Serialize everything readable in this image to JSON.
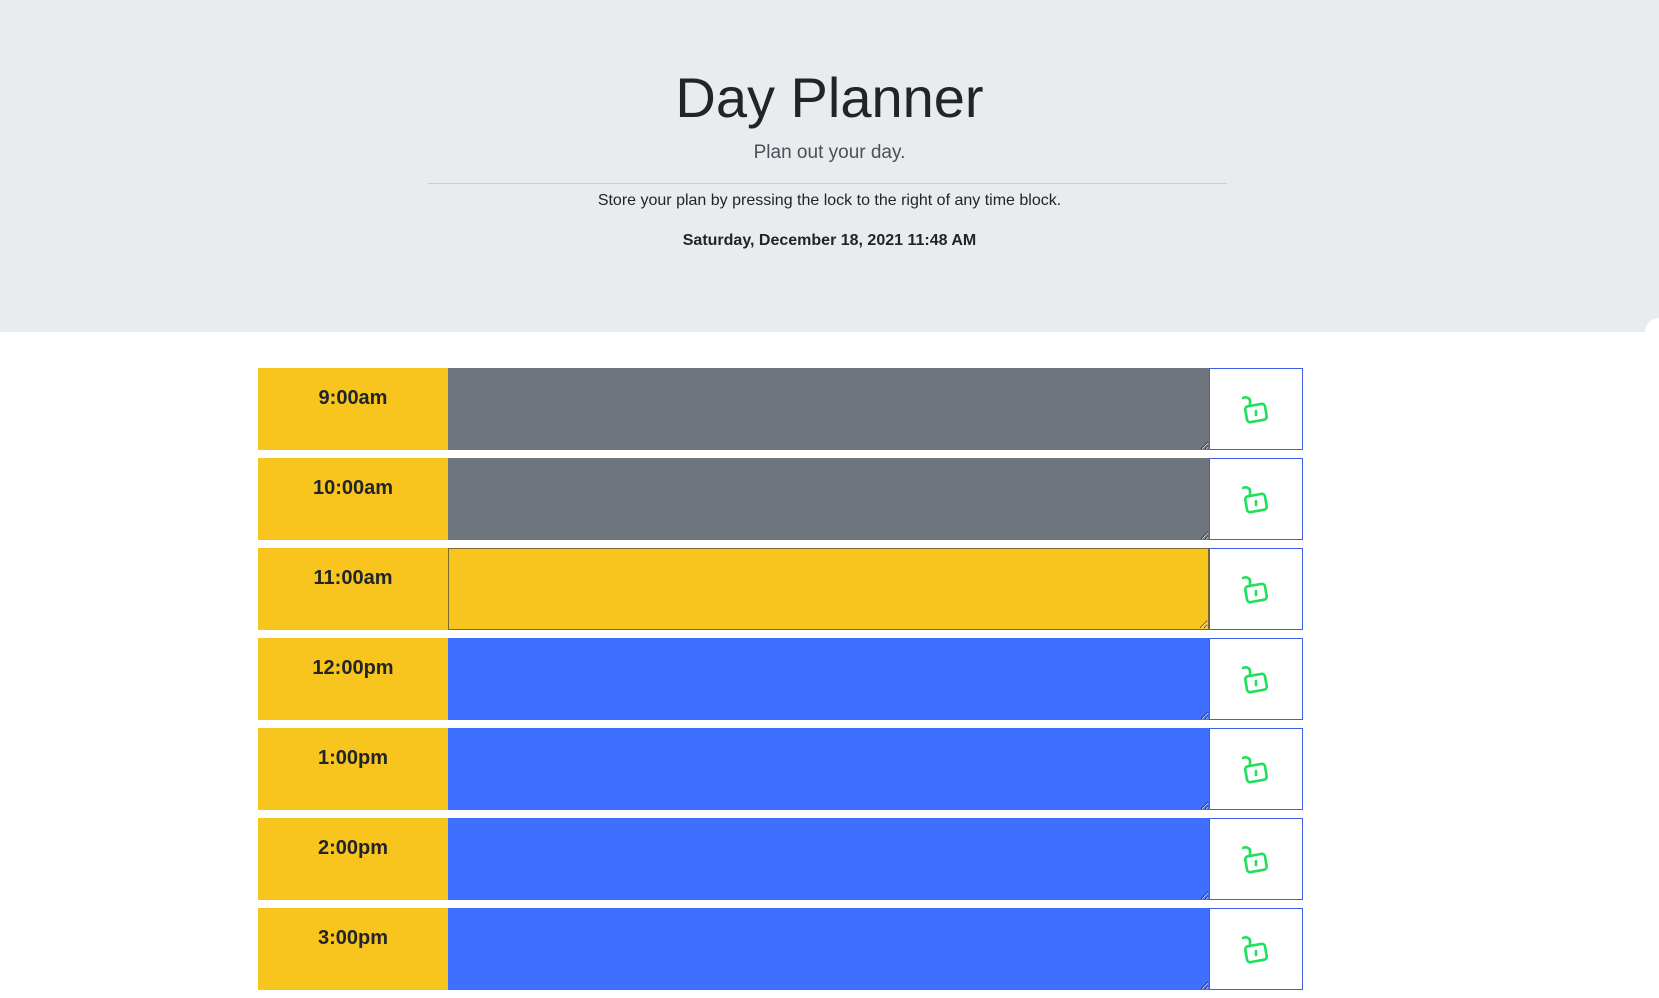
{
  "header": {
    "title": "Day Planner",
    "lead": "Plan out your day.",
    "instructions": "Store your plan by pressing the lock to the right of any time block.",
    "current_day": "Saturday, December 18, 2021 11:48 AM"
  },
  "colors": {
    "past": "#6e757c",
    "present": "#f8c51f",
    "future": "#3e6ffe",
    "hour_bg": "#f8c51f",
    "lock_icon": "#1fe05a",
    "jumbotron_bg": "#e9ecef"
  },
  "time_blocks": [
    {
      "hour": "9:00am",
      "status": "past",
      "text": "",
      "save_icon": "lock-open-icon"
    },
    {
      "hour": "10:00am",
      "status": "past",
      "text": "",
      "save_icon": "lock-open-icon"
    },
    {
      "hour": "11:00am",
      "status": "present",
      "text": "",
      "save_icon": "lock-open-icon"
    },
    {
      "hour": "12:00pm",
      "status": "future",
      "text": "",
      "save_icon": "lock-open-icon"
    },
    {
      "hour": "1:00pm",
      "status": "future",
      "text": "",
      "save_icon": "lock-open-icon"
    },
    {
      "hour": "2:00pm",
      "status": "future",
      "text": "",
      "save_icon": "lock-open-icon"
    },
    {
      "hour": "3:00pm",
      "status": "future",
      "text": "",
      "save_icon": "lock-open-icon"
    }
  ]
}
